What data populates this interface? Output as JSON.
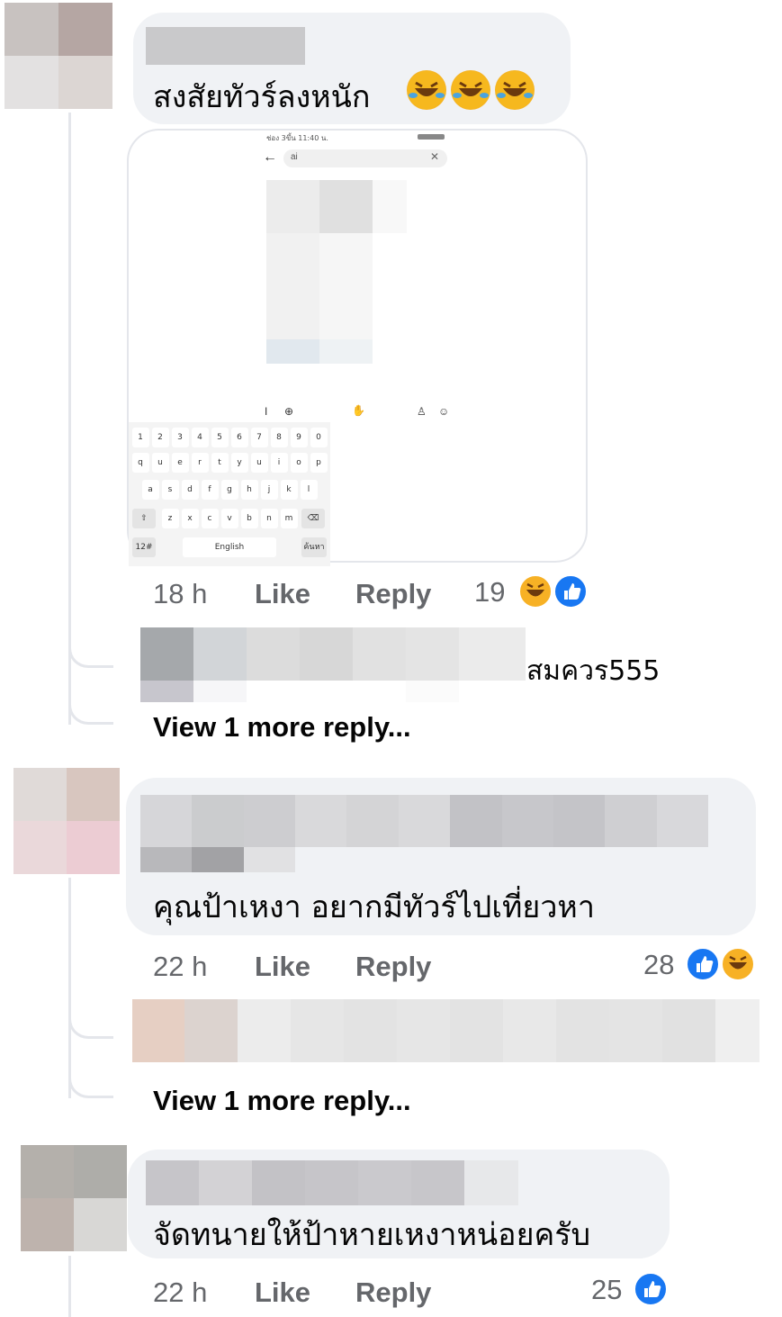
{
  "comments": [
    {
      "text": "สงสัยทัวร์ลงหนัก",
      "time": "18 h",
      "like_label": "Like",
      "reply_label": "Reply",
      "reaction_count": "19",
      "reactions": [
        "haha-icon",
        "like-icon"
      ],
      "emojis": [
        "rolling-laughing-emoji",
        "rolling-laughing-emoji",
        "rolling-laughing-emoji"
      ],
      "attachment": {
        "status_bar": "ช่อง 3ขึ้น 11:40 น.",
        "search_value": "ai",
        "keyboard_rows": [
          [
            "1",
            "2",
            "3",
            "4",
            "5",
            "6",
            "7",
            "8",
            "9",
            "0"
          ],
          [
            "q",
            "u",
            "e",
            "r",
            "t",
            "y",
            "u",
            "i",
            "o",
            "p"
          ],
          [
            "a",
            "s",
            "d",
            "f",
            "g",
            "h",
            "j",
            "k",
            "l"
          ],
          [
            "z",
            "x",
            "c",
            "v",
            "b",
            "n",
            "m"
          ]
        ],
        "space_label": "English",
        "mode_key": "12#",
        "search_key": "ค้นหา"
      },
      "reply": {
        "text": "สมควร555"
      },
      "view_more": "View 1 more reply..."
    },
    {
      "text": "คุณป้าเหงา อยากมีทัวร์ไปเที่ยวหา",
      "time": "22 h",
      "like_label": "Like",
      "reply_label": "Reply",
      "reaction_count": "28",
      "reactions": [
        "like-icon",
        "haha-icon"
      ],
      "view_more": "View 1 more reply..."
    },
    {
      "text": "จัดทนายให้ป้าหายเหงาหน่อยครับ",
      "time": "22 h",
      "like_label": "Like",
      "reply_label": "Reply",
      "reaction_count": "25",
      "reactions": [
        "like-icon"
      ]
    }
  ],
  "colors": {
    "bubble": "#f0f2f5",
    "meta_text": "#65676b",
    "like_blue": "#1877f2",
    "haha_yellow": "#f7b125"
  }
}
